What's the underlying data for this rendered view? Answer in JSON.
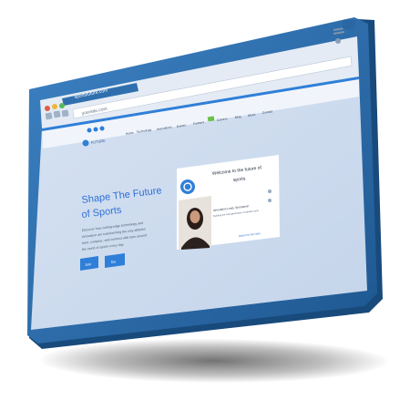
{
  "browser": {
    "tab_title": "sportsfuture.com",
    "address": "yoursite.com",
    "colors": {
      "frame": "#2f6fae",
      "frame_dark": "#1d4f82",
      "chrome": "#e9eef5",
      "page_bg": "#cddbee"
    }
  },
  "site": {
    "logo_text": "FUTURE",
    "nav": [
      "Home",
      "Technology",
      "Innovations",
      "Events",
      "Partners",
      "Careers",
      "Blog",
      "About",
      "Contact"
    ],
    "hero": {
      "title_line1": "Shape The Future",
      "title_line2": "of Sports",
      "body_lines": [
        "Discover how cutting-edge technology and",
        "innovation are transforming the way athletes",
        "train, compete, and connect with fans around",
        "the world of sports every day."
      ],
      "button_primary": "Join",
      "button_secondary": "Go"
    },
    "video_card": {
      "heading_line1": "Welcome to the future of",
      "heading_line2": "sports",
      "speaker_line1": "Innovation Lead, Sportstech",
      "speaker_line2": "Building the next generation of athletic tools",
      "footer_link": "Watch the full video",
      "icon": "play-logo-icon"
    }
  }
}
